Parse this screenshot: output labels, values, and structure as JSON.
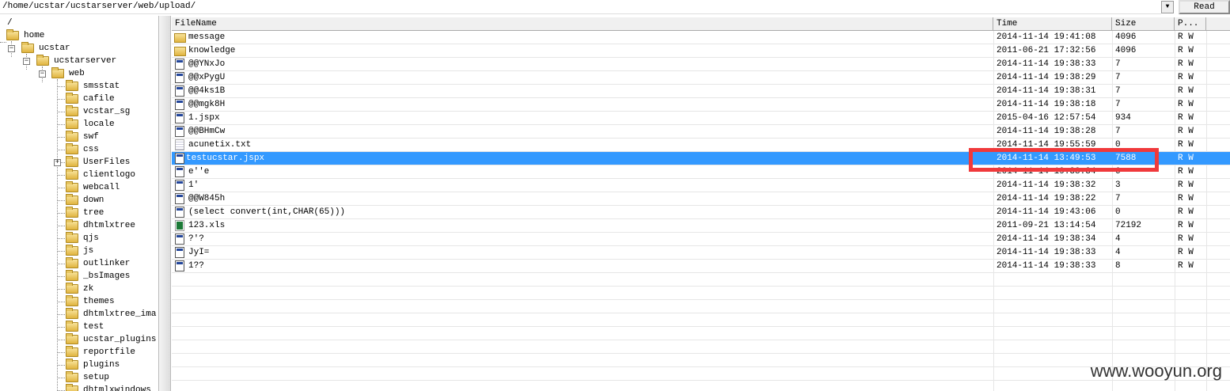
{
  "address": {
    "path": "/home/ucstar/ucstarserver/web/upload/",
    "read_label": "Read"
  },
  "tree": {
    "root": "/",
    "home": "home",
    "ucstar": "ucstar",
    "ucstarserver": "ucstarserver",
    "web": "web",
    "children": [
      "smsstat",
      "cafile",
      "vcstar_sg",
      "locale",
      "swf",
      "css",
      "UserFiles",
      "clientlogo",
      "webcall",
      "down",
      "tree",
      "dhtmlxtree",
      "qjs",
      "js",
      "outlinker",
      "_bsImages",
      "zk",
      "themes",
      "dhtmlxtree_ima",
      "test",
      "ucstar_plugins",
      "reportfile",
      "plugins",
      "setup",
      "dhtmlxwindows"
    ]
  },
  "columns": {
    "name": "FileName",
    "time": "Time",
    "size": "Size",
    "perm": "P..."
  },
  "files": [
    {
      "name": "message",
      "time": "2014-11-14 19:41:08",
      "size": "4096",
      "perm": "R W",
      "type": "dir"
    },
    {
      "name": "knowledge",
      "time": "2011-06-21 17:32:56",
      "size": "4096",
      "perm": "R W",
      "type": "dir"
    },
    {
      "name": "@@YNxJo",
      "time": "2014-11-14 19:38:33",
      "size": "7",
      "perm": "R W",
      "type": "file"
    },
    {
      "name": "@@xPygU",
      "time": "2014-11-14 19:38:29",
      "size": "7",
      "perm": "R W",
      "type": "file"
    },
    {
      "name": "@@4ks1B",
      "time": "2014-11-14 19:38:31",
      "size": "7",
      "perm": "R W",
      "type": "file"
    },
    {
      "name": "@@mgk8H",
      "time": "2014-11-14 19:38:18",
      "size": "7",
      "perm": "R W",
      "type": "file"
    },
    {
      "name": "1.jspx",
      "time": "2015-04-16 12:57:54",
      "size": "934",
      "perm": "R W",
      "type": "file"
    },
    {
      "name": "@@BHmCw",
      "time": "2014-11-14 19:38:28",
      "size": "7",
      "perm": "R W",
      "type": "file"
    },
    {
      "name": "acunetix.txt",
      "time": "2014-11-14 19:55:59",
      "size": "0",
      "perm": "R W",
      "type": "txt"
    },
    {
      "name": "testucstar.jspx",
      "time": "2014-11-14 13:49:53",
      "size": "7588",
      "perm": "R W",
      "type": "file",
      "selected": true
    },
    {
      "name": "e''e",
      "time": "2014-11-14 19:38:34",
      "size": "6",
      "perm": "R W",
      "type": "file"
    },
    {
      "name": "1'",
      "time": "2014-11-14 19:38:32",
      "size": "3",
      "perm": "R W",
      "type": "file"
    },
    {
      "name": "@@W845h",
      "time": "2014-11-14 19:38:22",
      "size": "7",
      "perm": "R W",
      "type": "file"
    },
    {
      "name": "(select convert(int,CHAR(65)))",
      "time": "2014-11-14 19:43:06",
      "size": "0",
      "perm": "R W",
      "type": "file"
    },
    {
      "name": "123.xls",
      "time": "2011-09-21 13:14:54",
      "size": "72192",
      "perm": "R W",
      "type": "xls"
    },
    {
      "name": "?'?",
      "time": "2014-11-14 19:38:34",
      "size": "4",
      "perm": "R W",
      "type": "file"
    },
    {
      "name": "JyI=",
      "time": "2014-11-14 19:38:33",
      "size": "4",
      "perm": "R W",
      "type": "file"
    },
    {
      "name": "1??",
      "time": "2014-11-14 19:38:33",
      "size": "8",
      "perm": "R W",
      "type": "file"
    }
  ],
  "watermark": "www.wooyun.org",
  "colors": {
    "selection": "#3399ff",
    "highlight_box": "#f0393b"
  }
}
